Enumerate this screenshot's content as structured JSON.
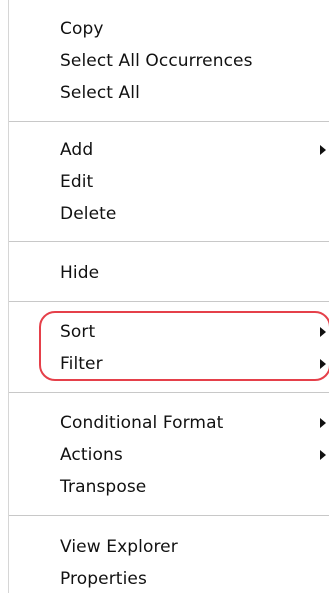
{
  "menu": {
    "groups": [
      {
        "items": [
          {
            "label": "Copy",
            "submenu": false
          },
          {
            "label": "Select All Occurrences",
            "submenu": false
          },
          {
            "label": "Select All",
            "submenu": false
          }
        ]
      },
      {
        "items": [
          {
            "label": "Add",
            "submenu": true
          },
          {
            "label": "Edit",
            "submenu": false
          },
          {
            "label": "Delete",
            "submenu": false
          }
        ]
      },
      {
        "items": [
          {
            "label": "Hide",
            "submenu": false
          }
        ]
      },
      {
        "items": [
          {
            "label": "Sort",
            "submenu": true
          },
          {
            "label": "Filter",
            "submenu": true
          }
        ]
      },
      {
        "items": [
          {
            "label": "Conditional Format",
            "submenu": true
          },
          {
            "label": "Actions",
            "submenu": true
          },
          {
            "label": "Transpose",
            "submenu": false
          }
        ]
      },
      {
        "items": [
          {
            "label": "View Explorer",
            "submenu": false
          },
          {
            "label": "Properties",
            "submenu": false
          }
        ]
      }
    ]
  },
  "colors": {
    "highlight": "#e5404a",
    "separator": "#c8c8c8",
    "text": "#111111"
  },
  "icons": {
    "submenu_arrow": "triangle-right-icon"
  }
}
